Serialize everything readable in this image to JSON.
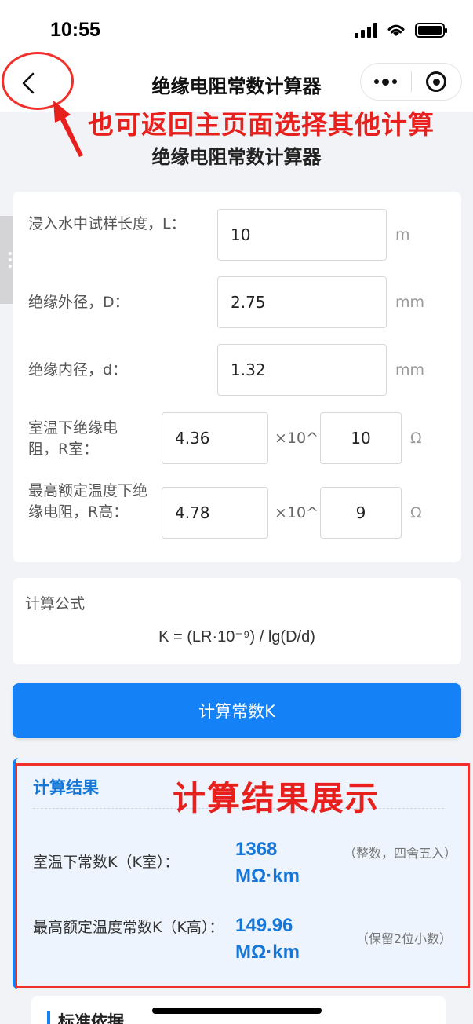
{
  "status_bar": {
    "time": "10:55"
  },
  "nav": {
    "title": "绝缘电阻常数计算器"
  },
  "annotations": {
    "back_hint": "也可返回主页面选择其他计算",
    "result_hint": "计算结果展示"
  },
  "page": {
    "title": "绝缘电阻常数计算器"
  },
  "form": {
    "length": {
      "label": "浸入水中试样长度，L：",
      "value": "10",
      "unit": "m"
    },
    "outer_diameter": {
      "label": "绝缘外径，D：",
      "value": "2.75",
      "unit": "mm"
    },
    "inner_diameter": {
      "label": "绝缘内径，d：",
      "value": "1.32",
      "unit": "mm"
    },
    "room_resistance": {
      "label": "室温下绝缘电阻，R室：",
      "mantissa": "4.36",
      "multiplier": "×10^",
      "exponent": "10",
      "unit": "Ω"
    },
    "max_temp_resistance": {
      "label": "最高额定温度下绝缘电阻，R高：",
      "mantissa": "4.78",
      "multiplier": "×10^",
      "exponent": "9",
      "unit": "Ω"
    }
  },
  "formula": {
    "label": "计算公式",
    "text": "K = (LR·10⁻⁹) / lg(D/d)"
  },
  "calculate_button": {
    "label": "计算常数K"
  },
  "result": {
    "title": "计算结果",
    "room": {
      "label": "室温下常数K（K室）：",
      "value": "1368",
      "unit": "MΩ·km",
      "note": "（整数，四舍五入）"
    },
    "max_temp": {
      "label": "最高额定温度常数K（K高）：",
      "value": "149.96",
      "unit": "MΩ·km",
      "note": "（保留2位小数）"
    }
  },
  "standard": {
    "title": "标准依据"
  },
  "colors": {
    "primary": "#1581f7",
    "result_text": "#1677d9",
    "annotation": "#f0302a",
    "result_bg": "#eef4fd"
  }
}
